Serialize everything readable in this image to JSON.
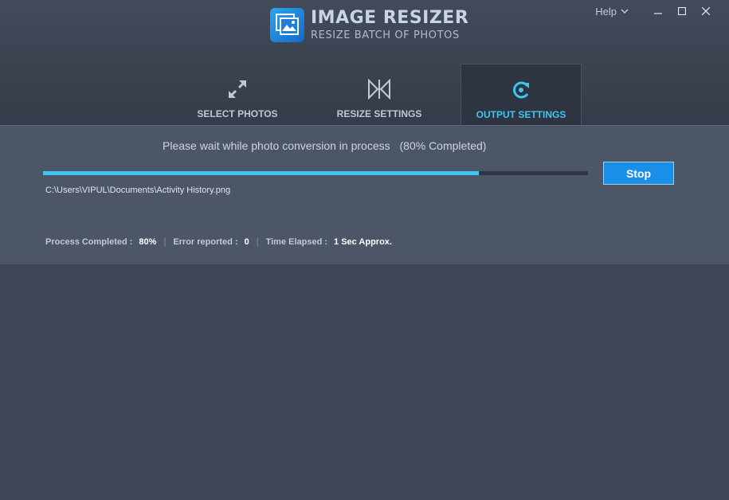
{
  "app": {
    "title": "IMAGE RESIZER",
    "subtitle": "RESIZE BATCH OF PHOTOS",
    "logo_icon": "photos-icon"
  },
  "window_controls": {
    "help_label": "Help",
    "help_icon": "chevron-down-icon",
    "minimize_icon": "minimize-icon",
    "maximize_icon": "maximize-icon",
    "close_icon": "close-icon"
  },
  "tabs": [
    {
      "label": "SELECT PHOTOS",
      "icon": "expand-arrows-icon",
      "active": false
    },
    {
      "label": "RESIZE SETTINGS",
      "icon": "resize-icon",
      "active": false
    },
    {
      "label": "OUTPUT SETTINGS",
      "icon": "refresh-icon",
      "active": true
    }
  ],
  "progress": {
    "message": "Please wait while photo conversion in process",
    "percent_text": "(80% Completed)",
    "fraction": 0.8,
    "file_path": "C:\\Users\\VIPUL\\Documents\\Activity History.png",
    "stop_label": "Stop"
  },
  "stats": {
    "process_label": "Process Completed :",
    "process_value": "80%",
    "error_label": "Error reported :",
    "error_value": "0",
    "time_label": "Time Elapsed :",
    "time_value": "1 Sec  Approx."
  },
  "colors": {
    "accent": "#3ec6ee",
    "button": "#1a8fe8",
    "background": "#3e4554",
    "panel": "#4d5666"
  }
}
